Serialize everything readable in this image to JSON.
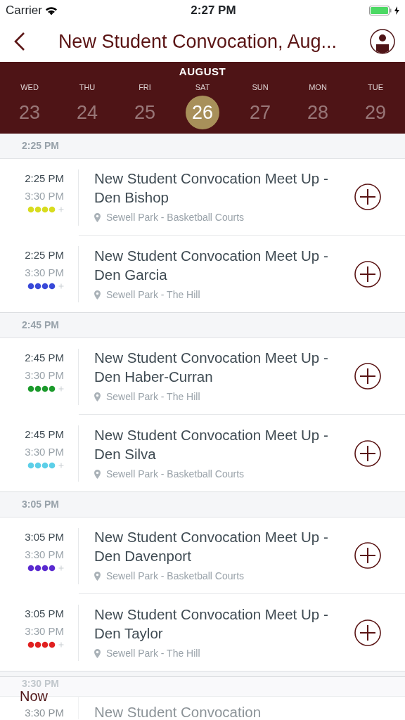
{
  "status_bar": {
    "carrier": "Carrier",
    "time": "2:27 PM"
  },
  "nav": {
    "title": "New Student Convocation, Aug..."
  },
  "calendar": {
    "month": "AUGUST",
    "days": [
      {
        "weekday": "WED",
        "date": "23",
        "selected": false
      },
      {
        "weekday": "THU",
        "date": "24",
        "selected": false
      },
      {
        "weekday": "FRI",
        "date": "25",
        "selected": false
      },
      {
        "weekday": "SAT",
        "date": "26",
        "selected": true
      },
      {
        "weekday": "SUN",
        "date": "27",
        "selected": false
      },
      {
        "weekday": "MON",
        "date": "28",
        "selected": false
      },
      {
        "weekday": "TUE",
        "date": "29",
        "selected": false
      }
    ]
  },
  "groups": [
    {
      "header": "2:25 PM",
      "events": [
        {
          "start": "2:25 PM",
          "end": "3:30 PM",
          "title": "New Student Convocation Meet Up - Den Bishop",
          "location": "Sewell Park - Basketball Courts",
          "color": "#d8dc1e"
        },
        {
          "start": "2:25 PM",
          "end": "3:30 PM",
          "title": "New Student Convocation Meet Up - Den Garcia",
          "location": "Sewell Park - The Hill",
          "color": "#3848d8"
        }
      ]
    },
    {
      "header": "2:45 PM",
      "events": [
        {
          "start": "2:45 PM",
          "end": "3:30 PM",
          "title": "New Student Convocation Meet Up - Den Haber-Curran",
          "location": "Sewell Park - The Hill",
          "color": "#1c9a2c"
        },
        {
          "start": "2:45 PM",
          "end": "3:30 PM",
          "title": "New Student Convocation Meet Up - Den Silva",
          "location": "Sewell Park - Basketball Courts",
          "color": "#5ccfe8"
        }
      ]
    },
    {
      "header": "3:05 PM",
      "events": [
        {
          "start": "3:05 PM",
          "end": "3:30 PM",
          "title": "New Student Convocation Meet Up - Den Davenport",
          "location": "Sewell Park - Basketball Courts",
          "color": "#5a2ad0"
        },
        {
          "start": "3:05 PM",
          "end": "3:30 PM",
          "title": "New Student Convocation Meet Up - Den Taylor",
          "location": "Sewell Park - The Hill",
          "color": "#e02020"
        }
      ]
    },
    {
      "header": "3:30 PM",
      "events": [
        {
          "start": "3:30 PM",
          "title": "New Student Convocation"
        }
      ]
    }
  ],
  "now_bar": {
    "label": "Now"
  }
}
